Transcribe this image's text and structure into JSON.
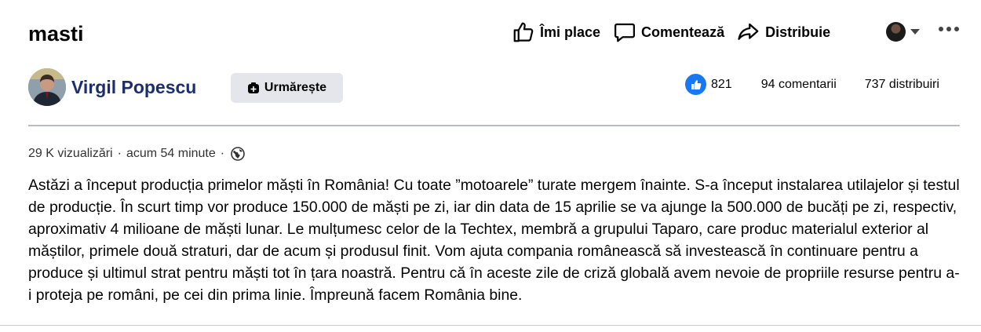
{
  "post": {
    "title": "masti",
    "author": "Virgil Popescu",
    "follow_label": "Urmărește",
    "meta": {
      "views": "29 K vizualizări",
      "separator": "·",
      "time": "acum 54 minute"
    },
    "body": "Astăzi a început producția primelor măști în România! Cu toate ”motoarele” turate mergem înainte. S-a început instalarea utilajelor și testul de producție. În scurt timp vor produce 150.000 de măști pe zi, iar din data de 15 aprilie se va ajunge la 500.000 de bucăți pe zi, respectiv, aproximativ 4 milioane de măști lunar. Le mulțumesc celor de la Techtex, membră a grupului Taparo, care produc materialul exterior al măștilor, primele două straturi, dar de acum și produsul finit. Vom ajuta compania românească să investească în continuare pentru a produce și ultimul strat pentru măști tot în țara noastră. Pentru că în aceste zile de criză globală avem nevoie de propriile resurse pentru a-i proteja pe români, pe cei din prima linie. Împreună facem România bine."
  },
  "actions": {
    "like": "Îmi place",
    "comment": "Comentează",
    "share": "Distribuie"
  },
  "stats": {
    "likes": "821",
    "comments": "94 comentarii",
    "shares": "737 distribuiri"
  },
  "icons": {
    "like": "thumbs-up-icon",
    "comment": "speech-bubble-icon",
    "share": "share-arrow-icon",
    "follow": "follow-plus-icon",
    "audience": "globe-icon",
    "more": "more-dots-icon"
  },
  "colors": {
    "author": "#1c2e6e",
    "like_badge": "#1877f2",
    "button_bg": "#e4e6eb"
  }
}
